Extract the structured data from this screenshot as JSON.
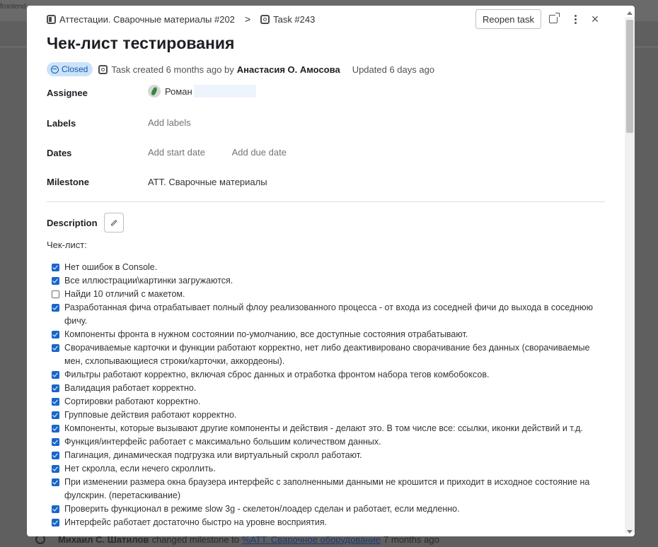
{
  "background": {
    "top_text": "frontend",
    "activity": {
      "author": "Михаил С. Шатилов",
      "action": "changed milestone to",
      "milestone": "%АТТ. Сварочное оборудование",
      "time": "7 months ago"
    }
  },
  "header": {
    "breadcrumbs": [
      {
        "label": "Аттестации. Сварочные материалы #202",
        "icon": "epic-icon"
      },
      {
        "label": "Task #243",
        "icon": "task-icon"
      }
    ],
    "separator": ">",
    "reopen_label": "Reopen task",
    "close_glyph": "×"
  },
  "task": {
    "title": "Чек-лист тестирования",
    "status": "Closed",
    "created_text": "Task created 6 months ago by",
    "author": "Анастасия О. Амосова",
    "updated": "Updated 6 days ago"
  },
  "fields": {
    "assignee_label": "Assignee",
    "assignee_name": "Роман",
    "labels_label": "Labels",
    "labels_placeholder": "Add labels",
    "dates_label": "Dates",
    "start_placeholder": "Add start date",
    "due_placeholder": "Add due date",
    "milestone_label": "Milestone",
    "milestone_value": "АТТ. Сварочные материалы"
  },
  "description": {
    "label": "Description",
    "checklist_title": "Чек-лист:",
    "items": [
      {
        "text": "Нет ошибок в Console.",
        "checked": true
      },
      {
        "text": "Все иллюстрации\\картинки загружаются.",
        "checked": true
      },
      {
        "text": "Найди 10 отличий с макетом.",
        "checked": false
      },
      {
        "text": "Разработанная фича отрабатывает полный флоу реализованного процесса - от входа из соседней фичи до выхода в соседнюю фичу.",
        "checked": true
      },
      {
        "text": "Компоненты фронта в нужном состоянии по-умолчанию, все доступные состояния отрабатывают.",
        "checked": true
      },
      {
        "text": "Сворачиваемые карточки и функции работают корректно, нет либо деактивировано сворачивание без данных (сворачиваемые мен, схлопывающиеся строки/карточки, аккордеоны).",
        "checked": true
      },
      {
        "text": "Фильтры работают корректно, включая сброс данных и отработка фронтом набора тегов комбобоксов.",
        "checked": true
      },
      {
        "text": "Валидация работает корректно.",
        "checked": true
      },
      {
        "text": "Сортировки работают корректно.",
        "checked": true
      },
      {
        "text": "Групповые действия работают корректно.",
        "checked": true
      },
      {
        "text": "Компоненты, которые вызывают другие компоненты и действия - делают это. В том числе все: ссылки, иконки действий и т.д.",
        "checked": true
      },
      {
        "text": "Функция/интерфейс работает с максимально большим количеством данных.",
        "checked": true
      },
      {
        "text": "Пагинация, динамическая подгрузка или виртуальный скролл работают.",
        "checked": true
      },
      {
        "text": "Нет скролла, если нечего скроллить.",
        "checked": true
      },
      {
        "text": "При изменении размера окна браузера интерфейс с заполненными данными не крошится и приходит в исходное состояние на фулскрин. (перетаскивание)",
        "checked": true
      },
      {
        "text": "Проверить функционал в режиме slow 3g - скелетон/лоадер сделан и работает, если медленно.",
        "checked": true
      },
      {
        "text": "Интерфейс работает достаточно быстро на уровне восприятия.",
        "checked": true
      }
    ]
  }
}
